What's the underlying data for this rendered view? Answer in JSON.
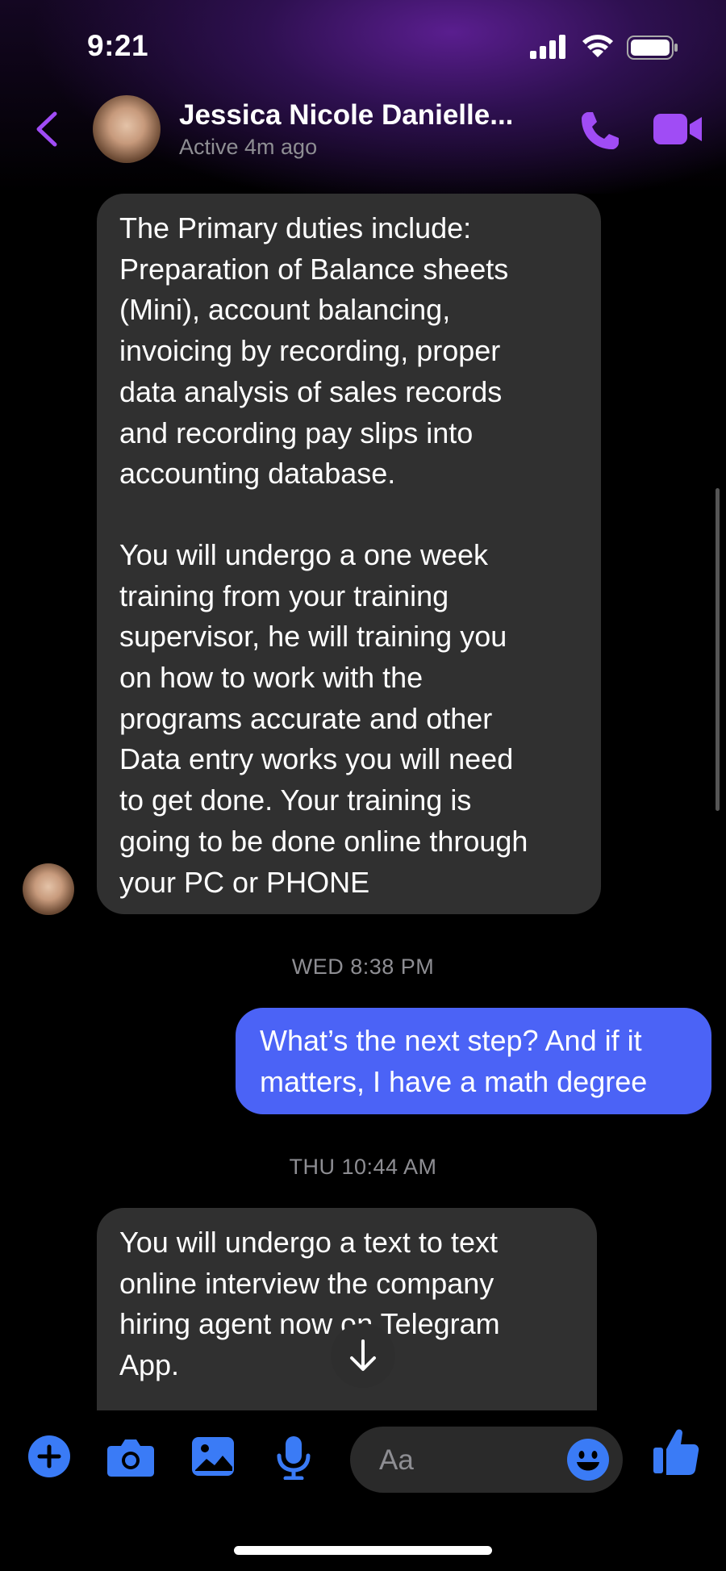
{
  "status_bar": {
    "time": "9:21"
  },
  "header": {
    "contact_name": "Jessica Nicole Danielle...",
    "contact_status": "Active 4m ago",
    "icons": [
      "back-chevron-icon",
      "phone-icon",
      "video-camera-icon"
    ],
    "accent_color": "#a04cf5"
  },
  "messages": [
    {
      "direction": "incoming",
      "paragraphs": [
        "The Primary duties include:\nPreparation of Balance sheets\n(Mini), account balancing,\ninvoicing by recording, proper\ndata analysis of sales records\nand recording pay slips into\naccounting database.",
        "You will undergo a one week\ntraining from your training\nsupervisor, he will training you\non how to work with the\nprograms accurate and other\nData entry works you will need\nto get done. Your training is\ngoing to be done online through\nyour PC or PHONE"
      ]
    },
    {
      "direction": "timestamp",
      "text": "WED 8:38 PM"
    },
    {
      "direction": "outgoing",
      "text": "What’s the next step? And if it\nmatters, I have a math degree"
    },
    {
      "direction": "timestamp",
      "text": "THU 10:44 AM"
    },
    {
      "direction": "incoming",
      "text": "You will undergo a text to text\nonline interview the company\nhiring agent now on Telegram\nApp."
    }
  ],
  "composer": {
    "placeholder": "Aa",
    "icons": [
      "plus-icon",
      "camera-icon",
      "gallery-icon",
      "microphone-icon",
      "emoji-icon",
      "thumbs-up-icon"
    ],
    "icon_color": "#3a7bf6"
  },
  "colors": {
    "incoming_bubble": "#303030",
    "outgoing_bubble": "#4b63f6",
    "background": "#000000"
  }
}
